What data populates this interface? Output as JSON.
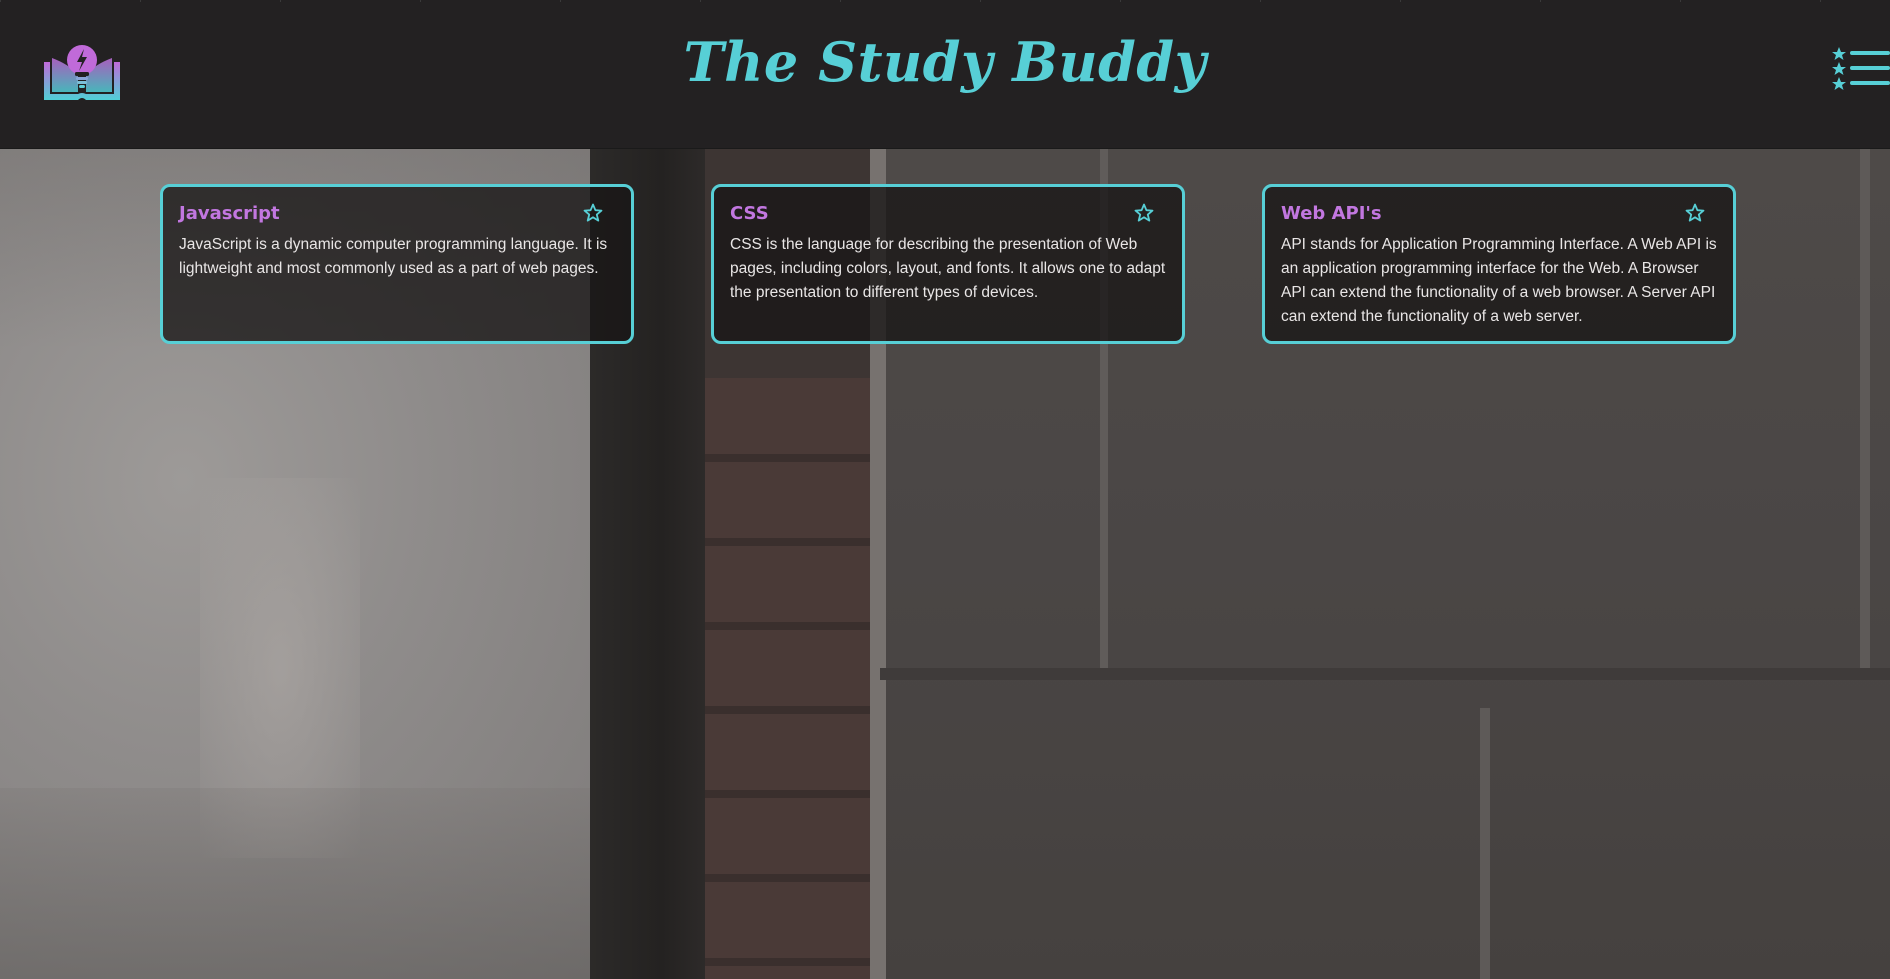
{
  "header": {
    "title": "The Study Buddy"
  },
  "icons": {
    "logo": "lightbulb-book-logo",
    "menu": "starred-list-menu-icon",
    "favorite": "star-outline-icon"
  },
  "colors": {
    "accent_teal": "#57cfd6",
    "card_title_purple": "#c277e0",
    "header_bg": "#232122",
    "card_text": "#e9e6e6"
  },
  "cards": [
    {
      "title": "Javascript",
      "text": "JavaScript is a dynamic computer programming language. It is lightweight and most commonly used as a part of web pages."
    },
    {
      "title": "CSS",
      "text": "CSS is the language for describing the presentation of Web pages, including colors, layout, and fonts. It allows one to adapt the presentation to different types of devices."
    },
    {
      "title": "Web API's",
      "text": "API stands for Application Programming Interface. A Web API is an application programming interface for the Web. A Browser API can extend the functionality of a web browser. A Server API can extend the functionality of a web server."
    }
  ]
}
